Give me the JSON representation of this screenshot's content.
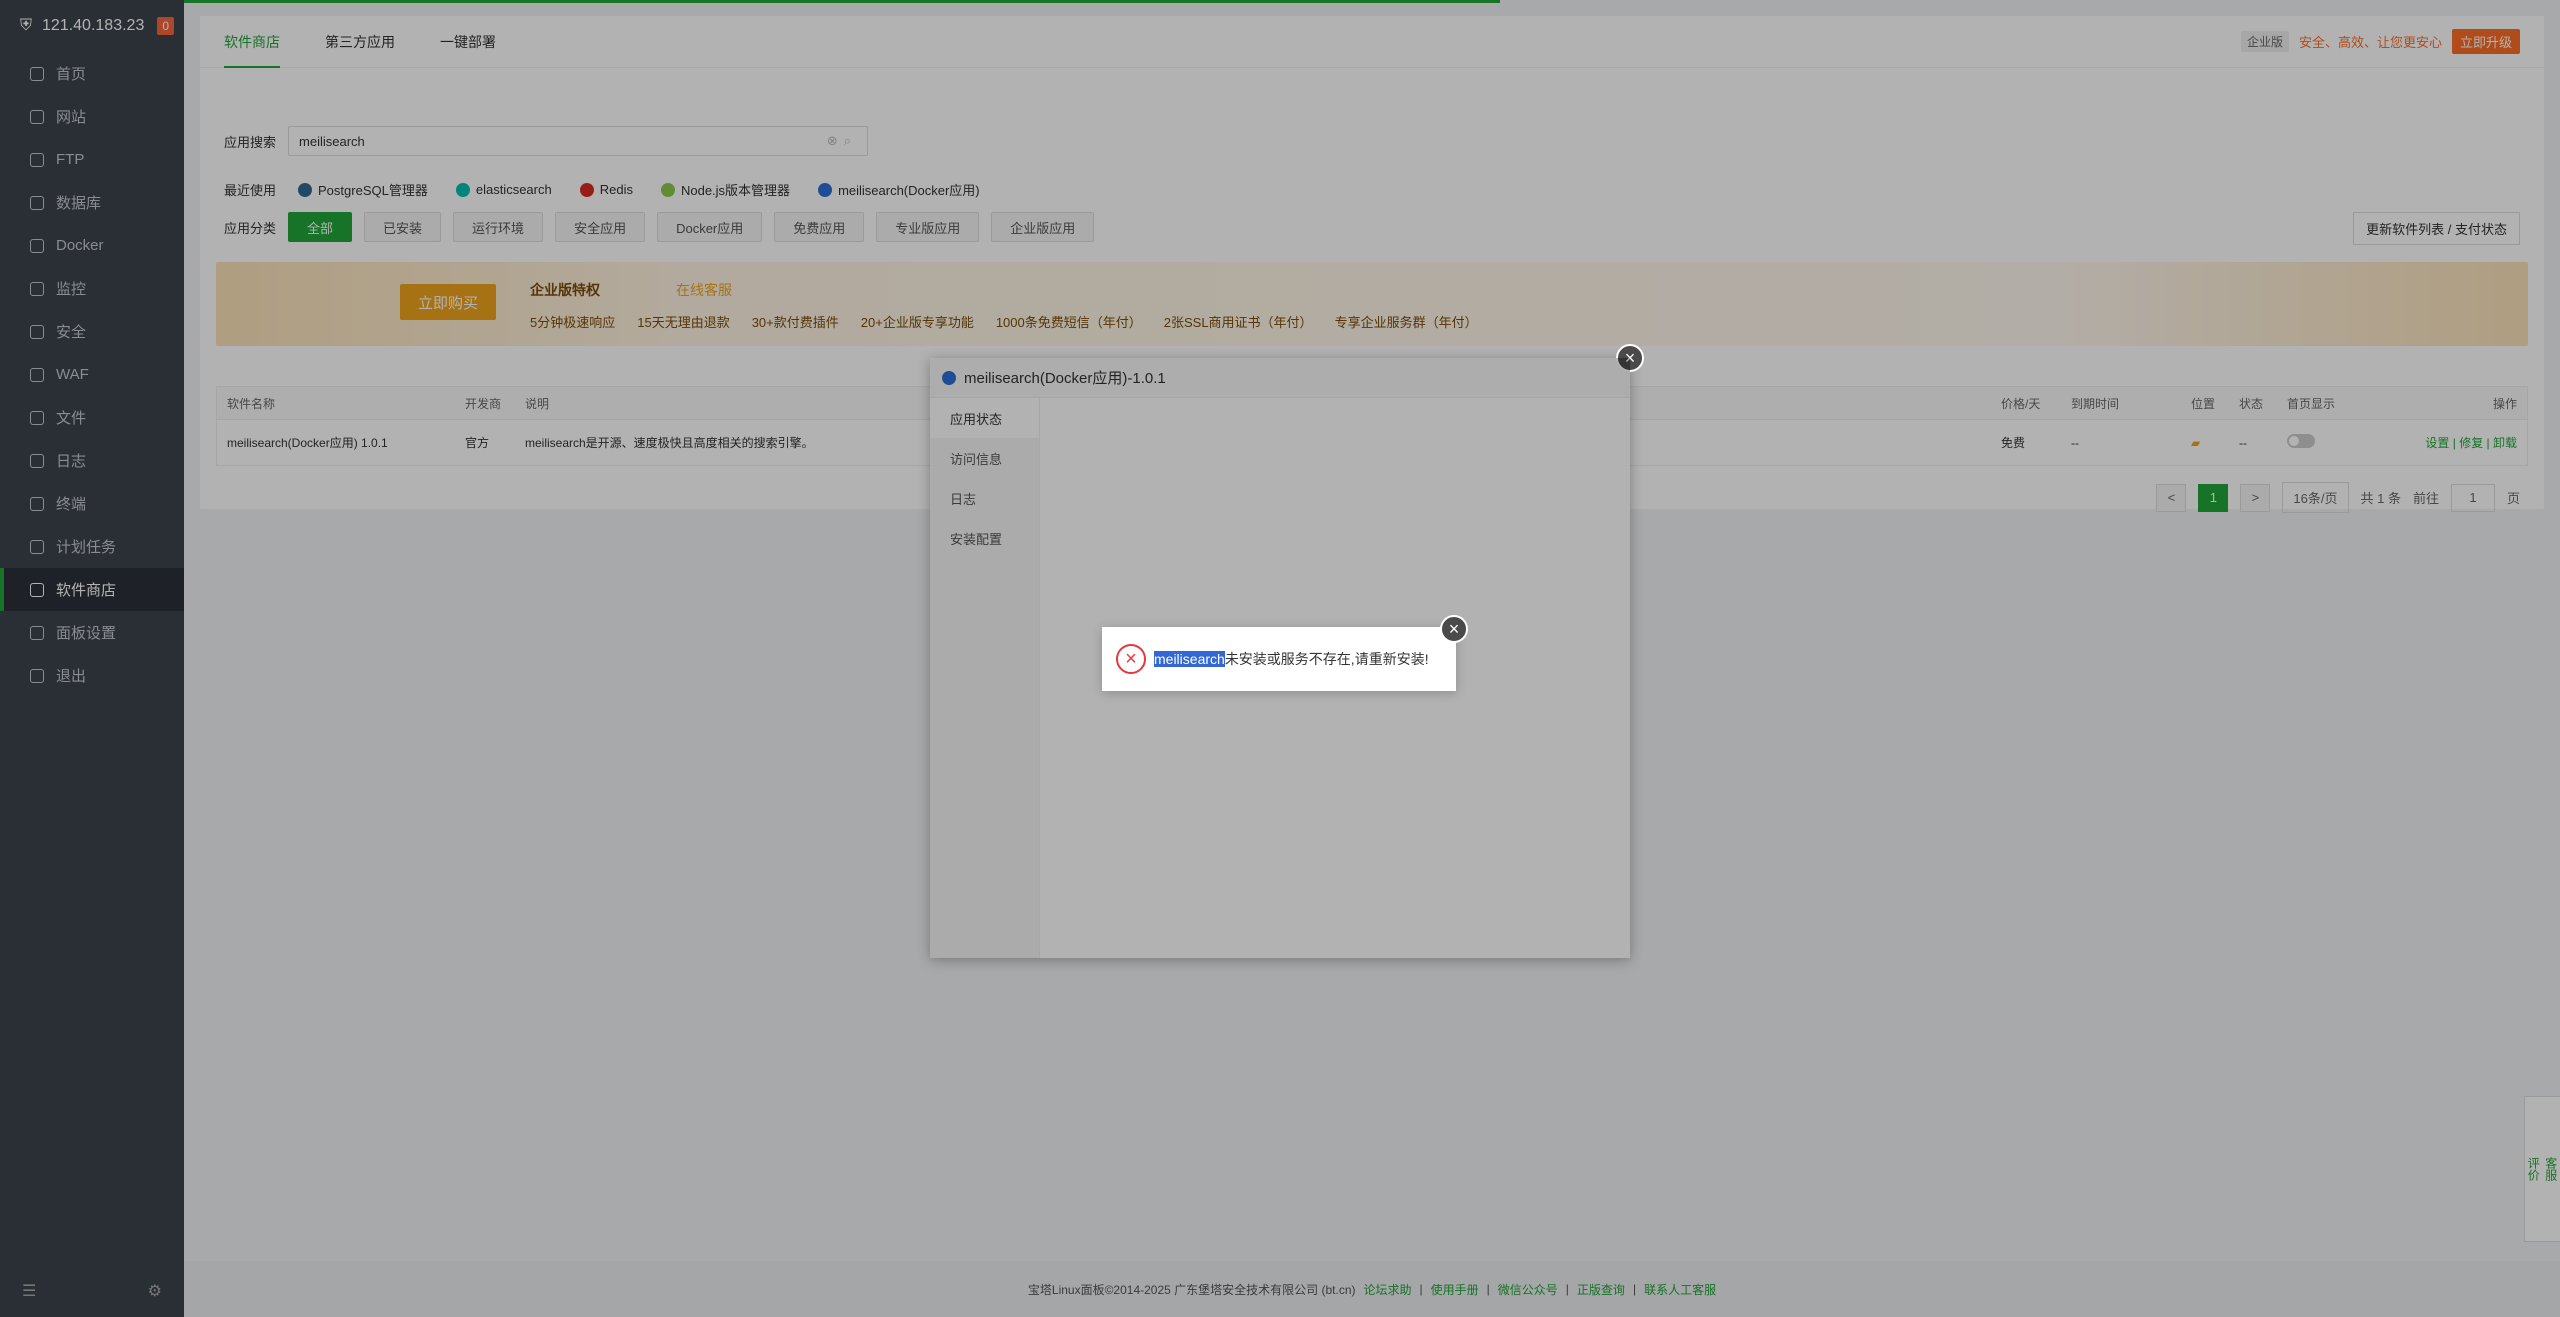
{
  "sidebar": {
    "ip": "121.40.183.23",
    "badge": "0",
    "items": [
      {
        "label": "首页"
      },
      {
        "label": "网站"
      },
      {
        "label": "FTP"
      },
      {
        "label": "数据库"
      },
      {
        "label": "Docker"
      },
      {
        "label": "监控"
      },
      {
        "label": "安全"
      },
      {
        "label": "WAF"
      },
      {
        "label": "文件"
      },
      {
        "label": "日志"
      },
      {
        "label": "终端"
      },
      {
        "label": "计划任务"
      },
      {
        "label": "软件商店"
      },
      {
        "label": "面板设置"
      },
      {
        "label": "退出"
      }
    ]
  },
  "tabs": [
    "软件商店",
    "第三方应用",
    "一键部署"
  ],
  "promo": {
    "pill": "企业版",
    "text": "安全、高效、让您更安心",
    "button": "立即升级"
  },
  "search": {
    "label": "应用搜索",
    "value": "meilisearch"
  },
  "recent": {
    "label": "最近使用",
    "items": [
      {
        "label": "PostgreSQL管理器",
        "color": "#336791"
      },
      {
        "label": "elasticsearch",
        "color": "#00bfb3"
      },
      {
        "label": "Redis",
        "color": "#d82c20"
      },
      {
        "label": "Node.js版本管理器",
        "color": "#8cc84b"
      },
      {
        "label": "meilisearch(Docker应用)",
        "color": "#2b6fd6"
      }
    ]
  },
  "categories": {
    "label": "应用分类",
    "items": [
      "全部",
      "已安装",
      "运行环境",
      "安全应用",
      "Docker应用",
      "免费应用",
      "专业版应用",
      "企业版应用"
    ],
    "refresh": "更新软件列表 / 支付状态"
  },
  "banner": {
    "buy": "立即购买",
    "enterprise": "企业版特权",
    "service": "在线客服",
    "features": [
      "5分钟极速响应",
      "15天无理由退款",
      "30+款付费插件",
      "20+企业版专享功能",
      "1000条免费短信（年付）",
      "2张SSL商用证书（年付）",
      "专享企业服务群（年付）"
    ]
  },
  "table": {
    "headers": [
      "软件名称",
      "开发商",
      "说明",
      "价格/天",
      "到期时间",
      "位置",
      "状态",
      "首页显示",
      "操作"
    ],
    "row": {
      "name": "meilisearch(Docker应用) 1.0.1",
      "vendor": "官方",
      "desc": "meilisearch是开源、速度极快且高度相关的搜索引擎。",
      "price": "免费",
      "expire": "--",
      "status": "--",
      "ops": "设置 | 修复 | 卸载"
    }
  },
  "pager": {
    "prev": "<",
    "current": "1",
    "next": ">",
    "size": "16条/页",
    "total": "共 1 条",
    "goto": "前往",
    "page": "1",
    "unit": "页"
  },
  "footer": {
    "copyright": "宝塔Linux面板©2014-2025 广东堡塔安全技术有限公司 (bt.cn)",
    "links": [
      "论坛求助",
      "使用手册",
      "微信公众号",
      "正版查询",
      "联系人工客服"
    ]
  },
  "side_float": [
    "客服",
    "评价"
  ],
  "dialog": {
    "title": "meilisearch(Docker应用)-1.0.1",
    "nav": [
      "应用状态",
      "访问信息",
      "日志",
      "安装配置"
    ]
  },
  "alert": {
    "highlight": "meilisearch",
    "message": "未安装或服务不存在,请重新安装!"
  }
}
